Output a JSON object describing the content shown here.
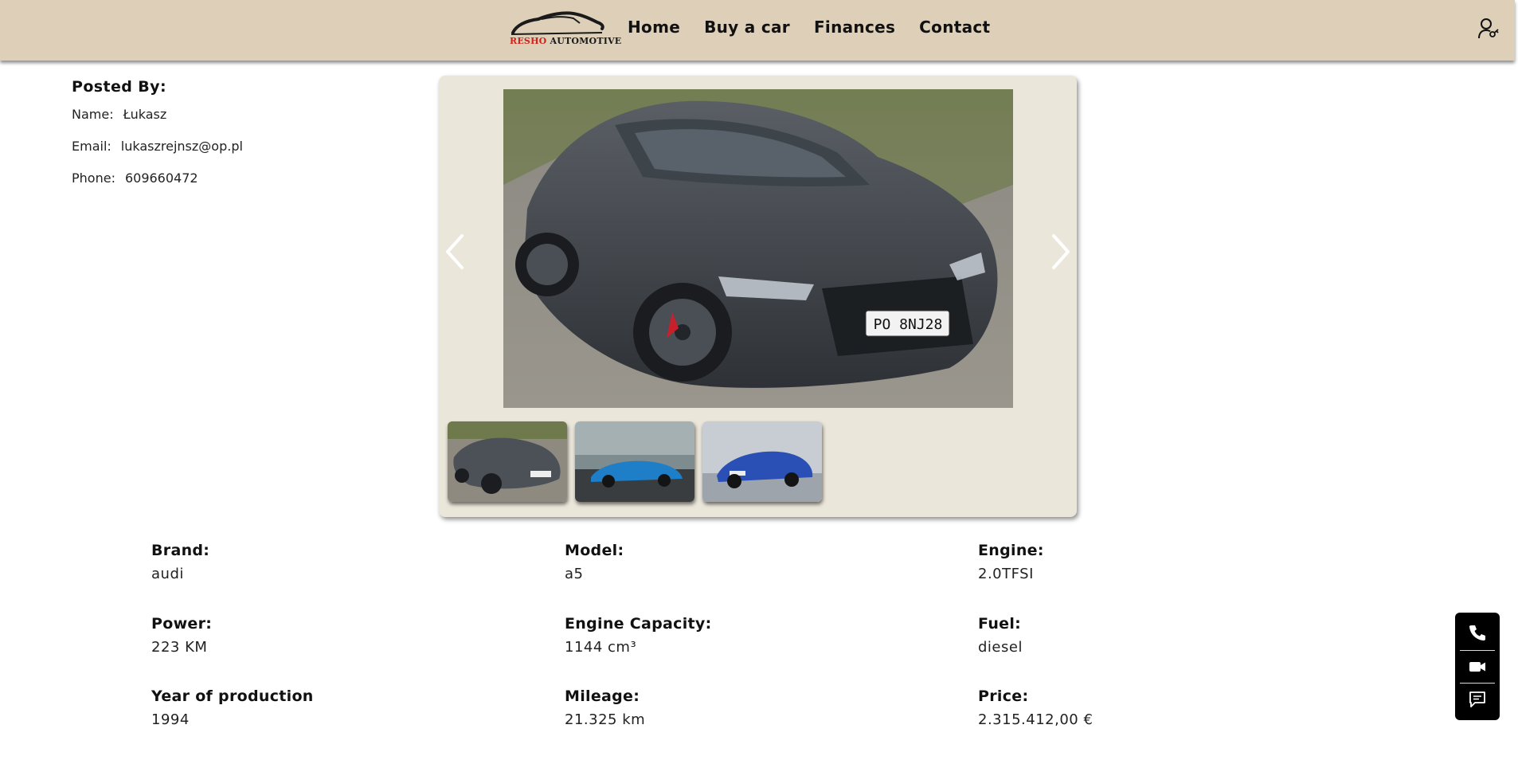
{
  "brand": {
    "logo_part1": "RESHO",
    "logo_part2": "AUTOMOTIVE",
    "accent_color": "#d0211b",
    "header_bg": "#ddcfb8"
  },
  "nav": {
    "home": "Home",
    "buy": "Buy a car",
    "finances": "Finances",
    "contact": "Contact",
    "user_icon": "user-key-icon"
  },
  "posted_by": {
    "title": "Posted By:",
    "name_label": "Name:",
    "name": "Łukasz",
    "email_label": "Email:",
    "email": "lukaszrejnsz@op.pl",
    "phone_label": "Phone:",
    "phone": "609660472"
  },
  "gallery": {
    "plate": "PO 8NJ28",
    "thumbnails": [
      "grey-audi-thumb",
      "blue-coupe-thumb",
      "blue-sportback-thumb"
    ],
    "prev_icon": "chevron-left-icon",
    "next_icon": "chevron-right-icon"
  },
  "specs": {
    "brand_label": "Brand:",
    "brand": "audi",
    "model_label": "Model:",
    "model": "a5",
    "engine_label": "Engine:",
    "engine": "2.0TFSI",
    "power_label": "Power:",
    "power": "223 KM",
    "capacity_label": "Engine Capacity:",
    "capacity": "1144 cm³",
    "fuel_label": "Fuel:",
    "fuel": "diesel",
    "year_label": "Year of production",
    "year": "1994",
    "mileage_label": "Mileage:",
    "mileage": "21.325 km",
    "price_label": "Price:",
    "price": "2.315.412,00 €"
  },
  "contact_widget": {
    "icons": [
      "phone-icon",
      "video-icon",
      "chat-icon"
    ]
  }
}
